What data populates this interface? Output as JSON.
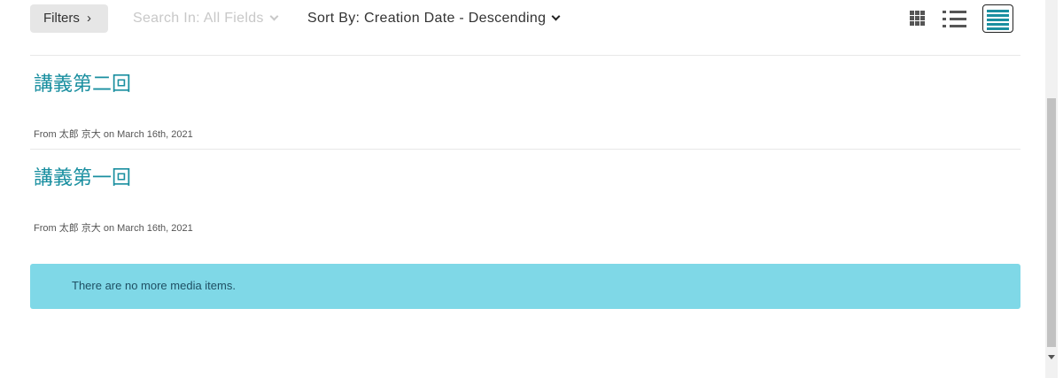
{
  "toolbar": {
    "filters_label": "Filters",
    "filters_chevron": "›",
    "search_in_label": "Search In: All Fields",
    "sort_by_label": "Sort By: Creation Date - Descending"
  },
  "view_modes": [
    "grid-icon",
    "list-icon",
    "detailed-list-icon"
  ],
  "active_view": "detailed-list-icon",
  "entries": [
    {
      "title": "講義第二回",
      "meta": "From 太郎 京大 on March 16th, 2021"
    },
    {
      "title": "講義第一回",
      "meta": "From 太郎 京大 on March 16th, 2021"
    }
  ],
  "alert": {
    "message": "There are no more media items."
  },
  "colors": {
    "accent": "#1a8fa0",
    "alert_bg": "#7fd8e7",
    "filters_bg": "#e6e6e6"
  }
}
